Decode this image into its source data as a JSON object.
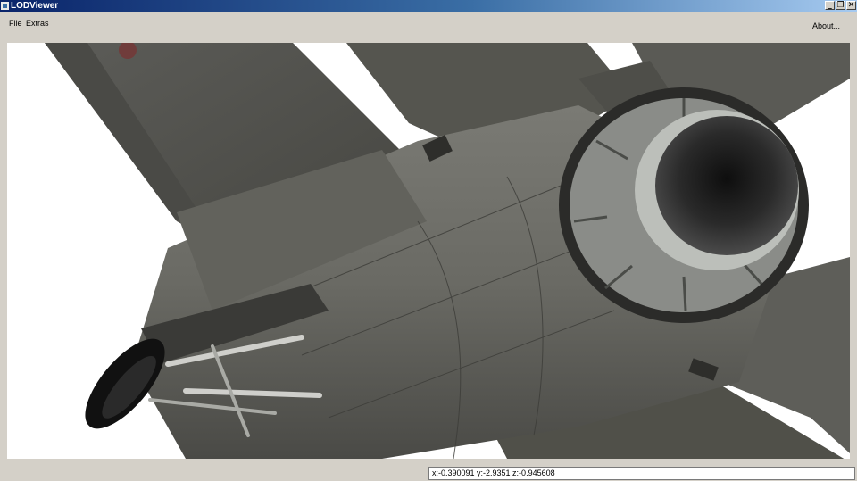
{
  "window": {
    "title": "LODViewer",
    "controls": {
      "minimize": "_",
      "restore": "❐",
      "close": "✕"
    }
  },
  "menu": {
    "file": "File",
    "extras": "Extras",
    "about": "About..."
  },
  "status": {
    "coordinates": "x:-0.390091 y:-2.9351 z:-0.945608"
  },
  "colors": {
    "titlebar_start": "#0a246a",
    "titlebar_end": "#a6caf0",
    "window_bg": "#d4d0c8",
    "viewport_bg": "#ffffff",
    "fuselage": "#6b6b66"
  },
  "viewport": {
    "content": "3d-aircraft-model"
  }
}
